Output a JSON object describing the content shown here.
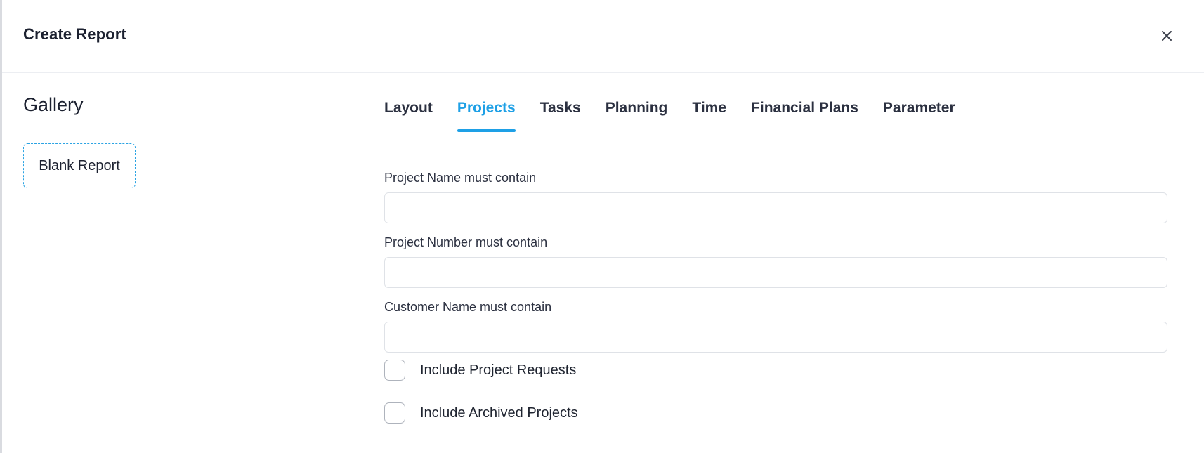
{
  "dialog": {
    "title": "Create Report",
    "close_icon": "close-icon"
  },
  "gallery": {
    "title": "Gallery",
    "items": [
      {
        "label": "Blank Report"
      }
    ]
  },
  "tabs": [
    {
      "label": "Layout",
      "active": false
    },
    {
      "label": "Projects",
      "active": true
    },
    {
      "label": "Tasks",
      "active": false
    },
    {
      "label": "Planning",
      "active": false
    },
    {
      "label": "Time",
      "active": false
    },
    {
      "label": "Financial Plans",
      "active": false
    },
    {
      "label": "Parameter",
      "active": false
    }
  ],
  "fields": [
    {
      "label": "Project Name must contain",
      "value": ""
    },
    {
      "label": "Project Number must contain",
      "value": ""
    },
    {
      "label": "Customer Name must contain",
      "value": ""
    }
  ],
  "checkboxes": [
    {
      "label": "Include Project Requests",
      "checked": false
    },
    {
      "label": "Include Archived Projects",
      "checked": false
    }
  ],
  "colors": {
    "accent": "#1ea0e6",
    "text": "#1f2430",
    "border": "#dfe2e7"
  }
}
